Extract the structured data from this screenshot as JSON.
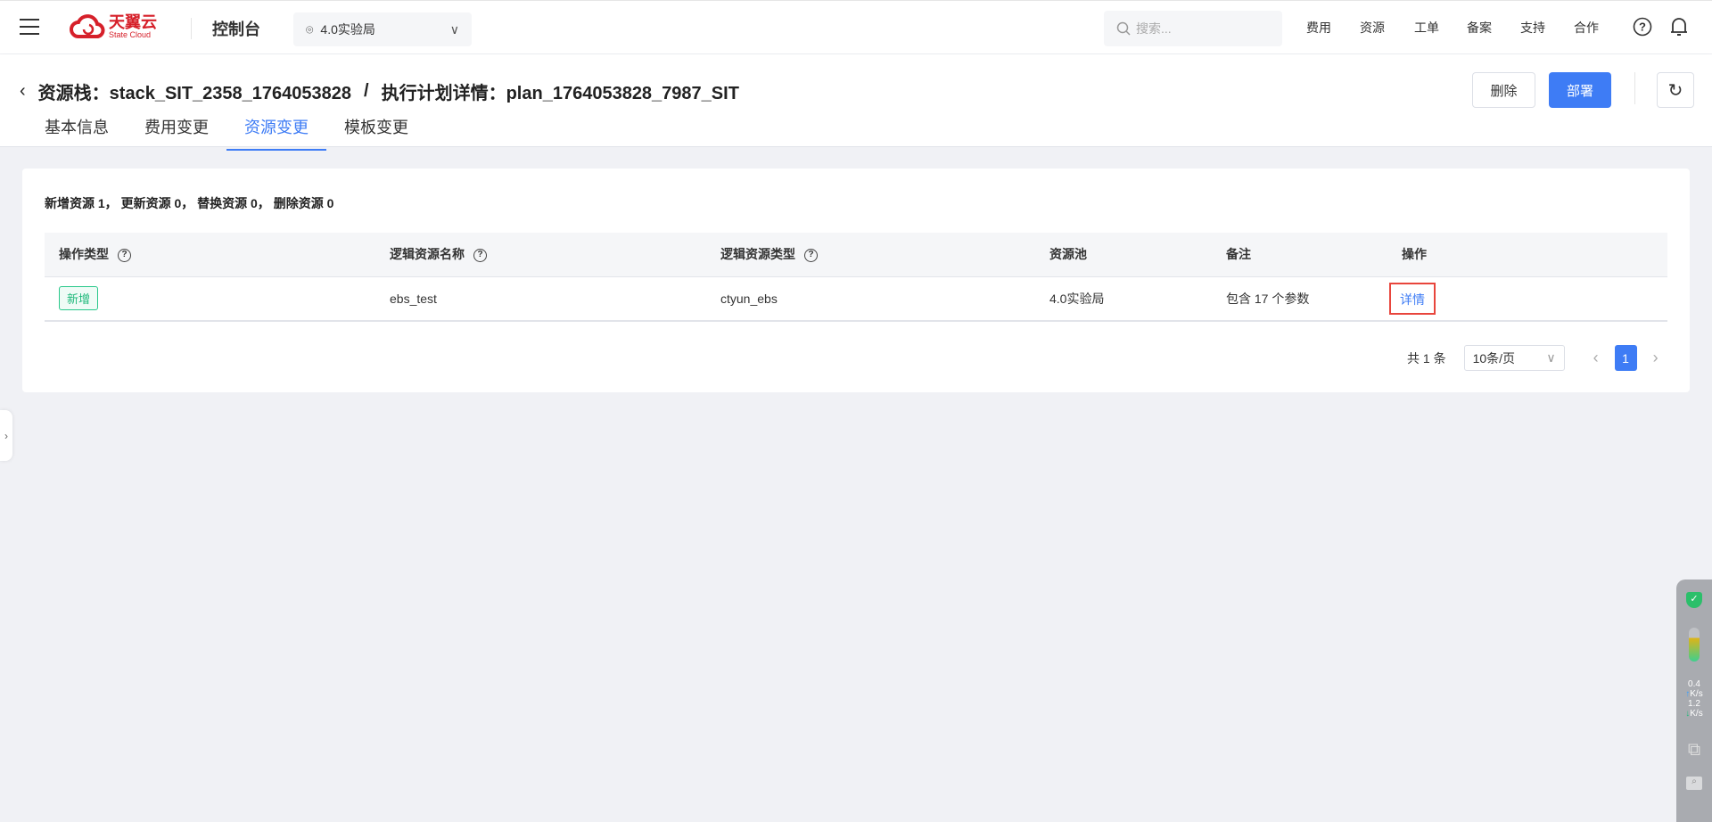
{
  "header": {
    "brand": "天翼云",
    "brand_en": "State Cloud",
    "console": "控制台",
    "region": "4.0实验局",
    "search_placeholder": "搜索...",
    "nav": [
      "费用",
      "资源",
      "工单",
      "备案",
      "支持",
      "合作"
    ]
  },
  "page": {
    "title_stack": "资源栈：stack_SIT_2358_1764053828",
    "separator": "/",
    "title_plan": "执行计划详情：plan_1764053828_7987_SIT",
    "delete_label": "删除",
    "deploy_label": "部署",
    "tabs": [
      {
        "label": "基本信息"
      },
      {
        "label": "费用变更"
      },
      {
        "label": "资源变更",
        "active": true
      },
      {
        "label": "模板变更"
      }
    ]
  },
  "summary": "新增资源 1， 更新资源 0， 替换资源 0， 删除资源 0",
  "table": {
    "columns": [
      "操作类型",
      "逻辑资源名称",
      "逻辑资源类型",
      "资源池",
      "备注",
      "操作"
    ],
    "rows": [
      {
        "op": "新增",
        "name": "ebs_test",
        "type": "ctyun_ebs",
        "pool": "4.0实验局",
        "note": "包含 17 个参数",
        "action": "详情"
      }
    ]
  },
  "pagination": {
    "total": "共 1 条",
    "page_size": "10条/页",
    "current": "1"
  },
  "widget": {
    "up": "0.4",
    "down": "1.2",
    "unit": "K/s"
  },
  "colors": {
    "accent": "#3e7cf5",
    "brand": "#d6202a",
    "new_tag": "#1fb97b",
    "highlight": "#e8453c"
  }
}
